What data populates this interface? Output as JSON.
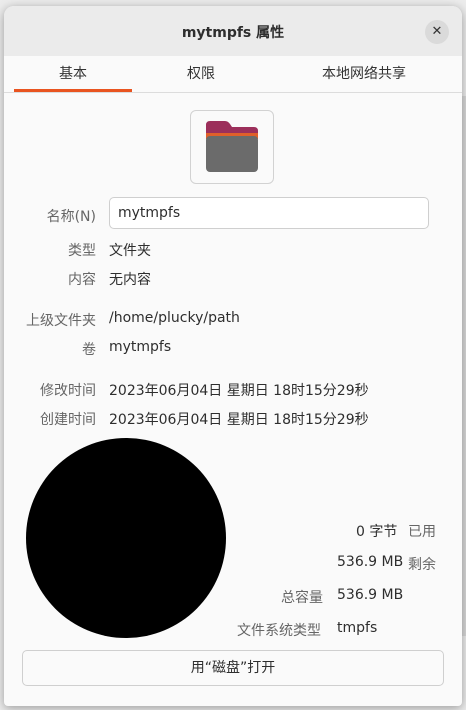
{
  "window": {
    "title": "mytmpfs 属性"
  },
  "tabs": [
    {
      "label": "基本"
    },
    {
      "label": "权限"
    },
    {
      "label": "本地网络共享"
    }
  ],
  "basic": {
    "name_label": "名称(N)",
    "name_value": "mytmpfs",
    "type_label": "类型",
    "type_value": "文件夹",
    "contents_label": "内容",
    "contents_value": "无内容",
    "parent_label": "上级文件夹",
    "parent_value": "/home/plucky/path",
    "volume_label": "卷",
    "volume_value": "mytmpfs",
    "modified_label": "修改时间",
    "modified_value": "2023年06月04日 星期日 18时15分29秒",
    "created_label": "创建时间",
    "created_value": "2023年06月04日 星期日 18时15分29秒"
  },
  "usage": {
    "used_value": "0 字节",
    "used_label": "已用",
    "free_value": "536.9 MB",
    "free_label": "剩余",
    "capacity_label": "总容量",
    "capacity_value": "536.9 MB",
    "fs_label": "文件系统类型",
    "fs_value": "tmpfs"
  },
  "open_button": "用“磁盘”打开",
  "icons": {
    "close": "close-icon",
    "folder": "folder-icon"
  },
  "colors": {
    "accent": "#e95420",
    "pie": "#000000"
  }
}
